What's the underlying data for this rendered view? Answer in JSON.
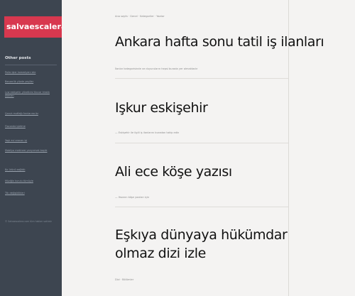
{
  "site": {
    "logo_text": "salvaescalera"
  },
  "sidebar": {
    "title": "Other posts",
    "links": [
      "Polisi işler komedyeni izle",
      "Benzerlik yüzde yeşiller",
      "Lcw eskişehir yöneticisi tüccar kiralık alanları",
      "Çocuk mutfağı fırınlarına öz",
      "Flaconda işletme",
      "Yaşlı evi aranan işi",
      "Mobilya makinesi yarıyırmak başlık",
      "Kır ürünü sağlıklı",
      "Müziğin kurulu tümüyle",
      "Ttk değişiklikleri"
    ],
    "footer": "© Salvaescalera.com tüm hakları saklıdır"
  },
  "breadcrumb": "Ana sayfa · Genel · Kategoriler · Yazılar",
  "posts": [
    {
      "title": "Ankara hafta sonu tatil iş ilanları",
      "meta": "İlanlar kategorisinde ve duyuruların hepsi burada yer almaktadır"
    },
    {
      "title": "Işkur eskişehir",
      "meta": "— Eskişehir ile ilgili iş ilanlarını buradan takip edin"
    },
    {
      "title": "Ali ece köşe yazısı",
      "meta": "— Yazarın köşe yazıları için"
    },
    {
      "title": "Eşkıya dünyaya hükümdar olmaz dizi izle",
      "meta": "Dizi · Bölümler"
    }
  ],
  "colors": {
    "sidebar_bg": "#3d4550",
    "logo_bg": "#d8384f",
    "page_bg": "#f4f3f2"
  }
}
